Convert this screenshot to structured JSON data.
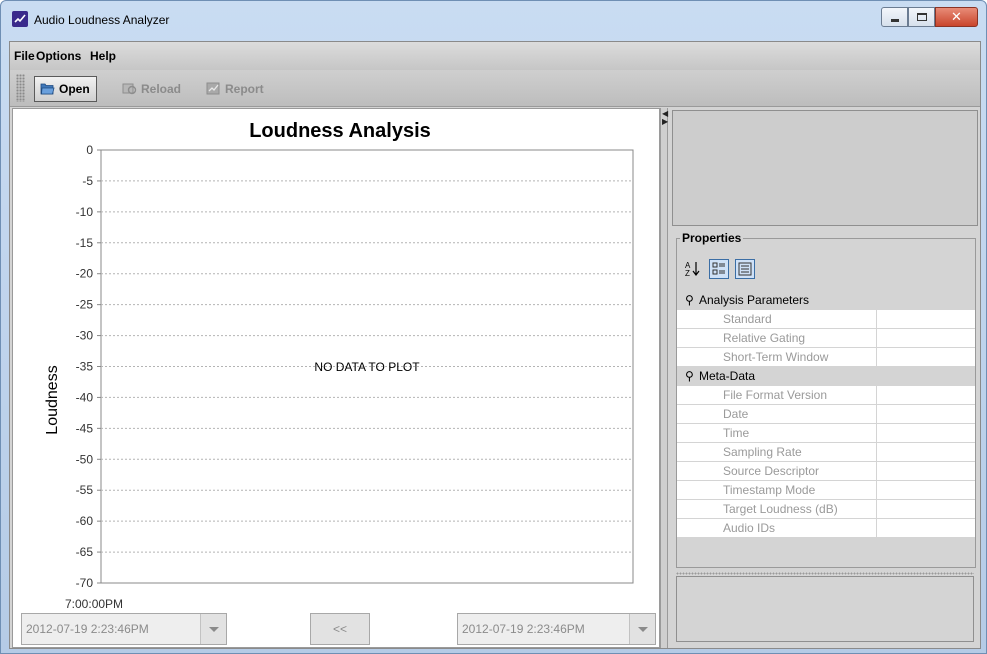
{
  "window": {
    "title": "Audio Loudness Analyzer"
  },
  "menu": [
    {
      "label": "File"
    },
    {
      "label": "Options"
    },
    {
      "label": "Help"
    }
  ],
  "toolbar": {
    "open_label": "Open",
    "reload_label": "Reload",
    "report_label": "Report"
  },
  "chart": {
    "title": "Loudness Analysis",
    "ylabel": "Loudness",
    "empty_message": "NO DATA TO PLOT",
    "x_start_label": "7:00:00PM"
  },
  "chart_data": {
    "type": "line",
    "title": "Loudness Analysis",
    "xlabel": "",
    "ylabel": "Loudness",
    "ylim": [
      -70,
      0
    ],
    "yticks": [
      0,
      -5,
      -10,
      -15,
      -20,
      -25,
      -30,
      -35,
      -40,
      -45,
      -50,
      -55,
      -60,
      -65,
      -70
    ],
    "xticks": [
      "7:00:00PM"
    ],
    "grid": true,
    "series": []
  },
  "controls": {
    "start_time": "2012-07-19 2:23:46PM",
    "end_time": "2012-07-19 2:23:46PM",
    "nav_label": "<<"
  },
  "properties": {
    "title": "Properties",
    "categories": [
      {
        "name": "Analysis Parameters",
        "rows": [
          {
            "name": "Standard",
            "value": ""
          },
          {
            "name": "Relative Gating",
            "value": ""
          },
          {
            "name": "Short-Term Window",
            "value": ""
          }
        ]
      },
      {
        "name": "Meta-Data",
        "rows": [
          {
            "name": "File Format Version",
            "value": ""
          },
          {
            "name": "Date",
            "value": ""
          },
          {
            "name": "Time",
            "value": ""
          },
          {
            "name": "Sampling Rate",
            "value": ""
          },
          {
            "name": "Source Descriptor",
            "value": ""
          },
          {
            "name": "Timestamp Mode",
            "value": ""
          },
          {
            "name": "Target Loudness (dB)",
            "value": ""
          },
          {
            "name": "Audio IDs",
            "value": ""
          }
        ]
      }
    ]
  }
}
